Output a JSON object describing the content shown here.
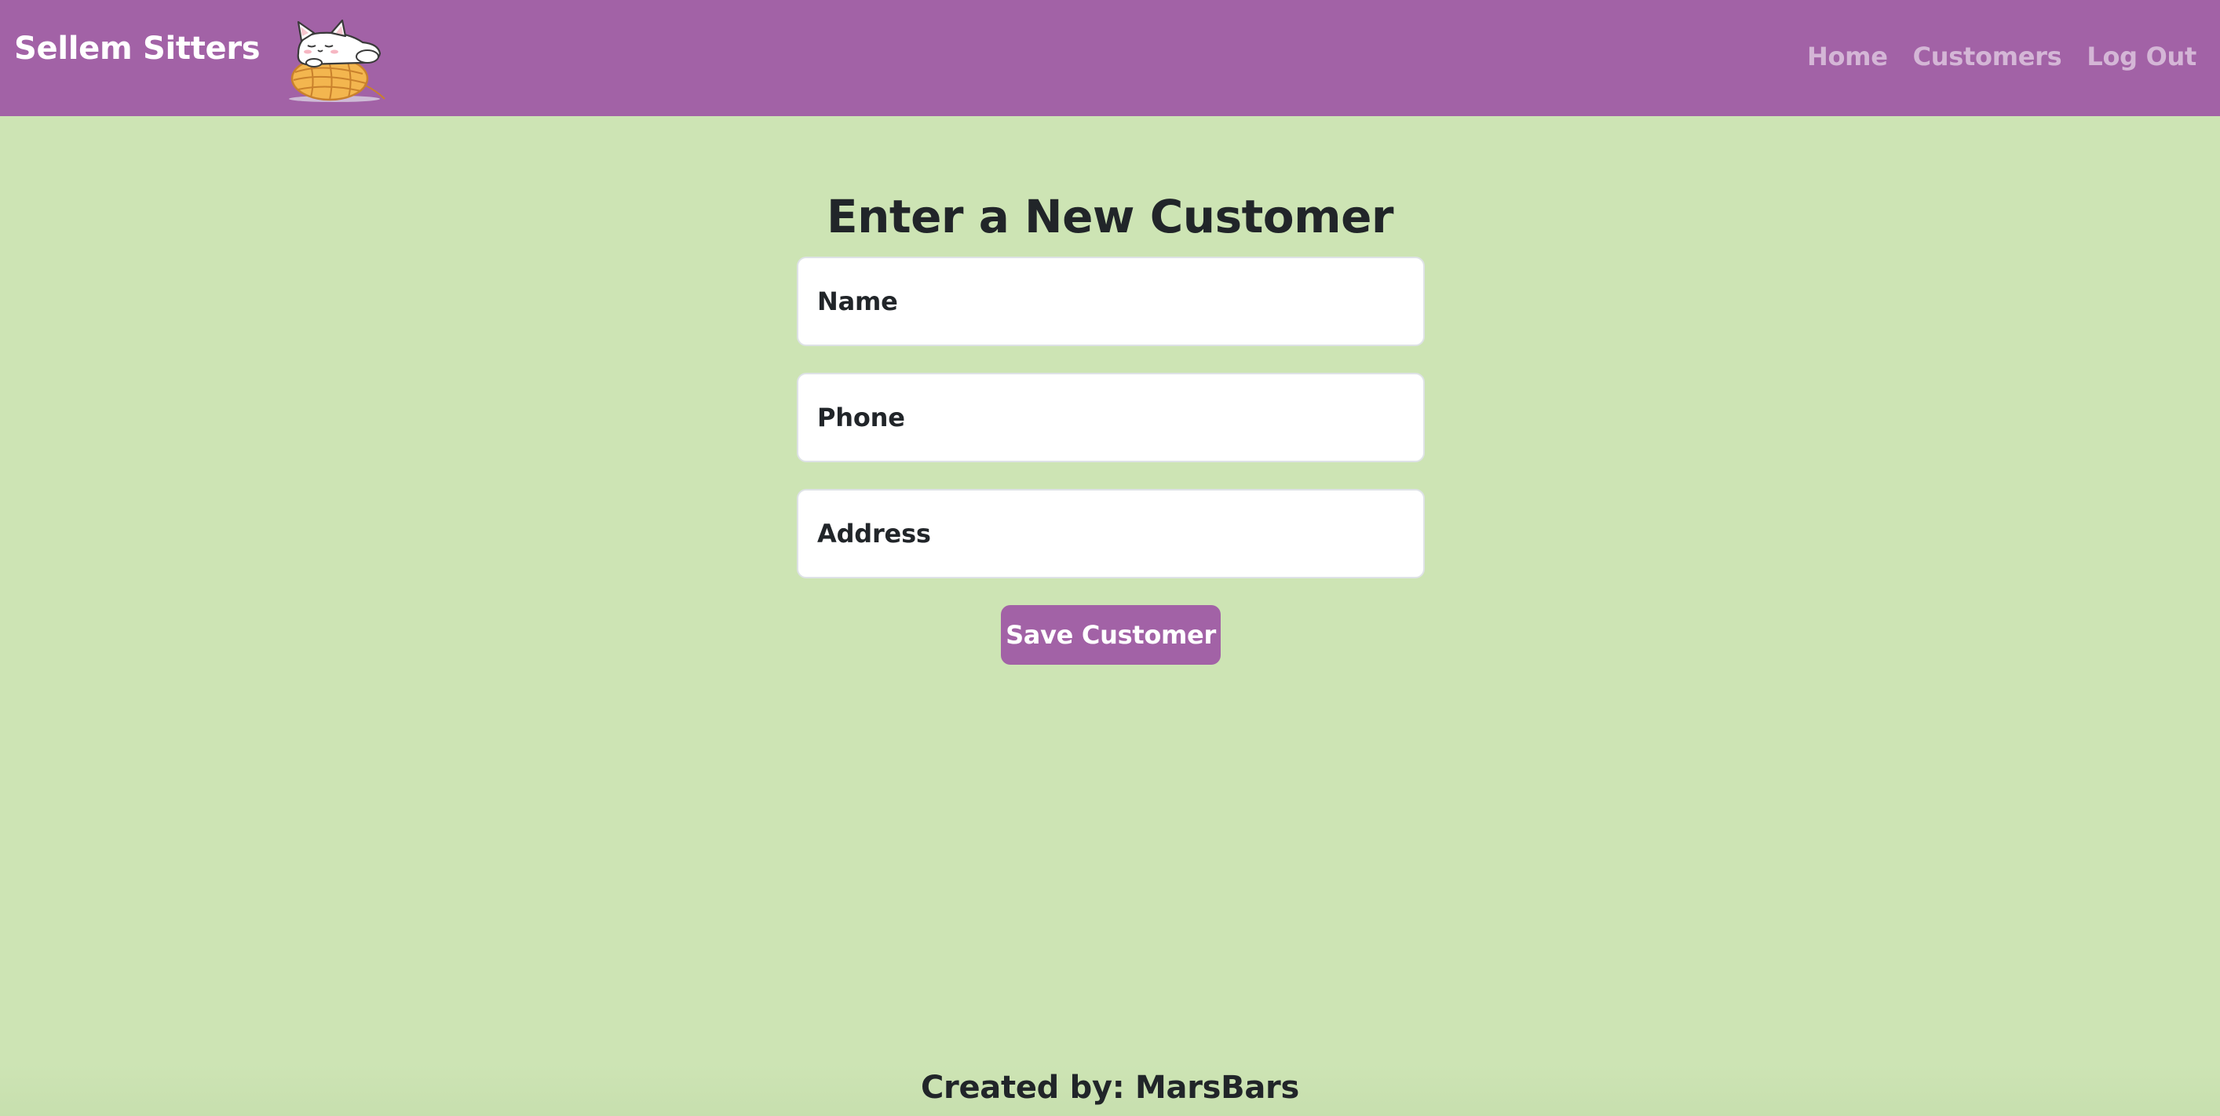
{
  "navbar": {
    "brand": "Sellem Sitters",
    "logo_icon": "cat-on-yarn-ball-icon",
    "links": [
      {
        "label": "Home"
      },
      {
        "label": "Customers"
      },
      {
        "label": "Log Out"
      }
    ]
  },
  "form": {
    "title": "Enter a New Customer",
    "fields": [
      {
        "label": "Name",
        "value": ""
      },
      {
        "label": "Phone",
        "value": ""
      },
      {
        "label": "Address",
        "value": ""
      }
    ],
    "submit_label": "Save Customer"
  },
  "footer": {
    "text": "Created by: MarsBars"
  },
  "colors": {
    "navbar": "#a262a6",
    "background": "#cde4b4",
    "nav_link": "#d4b6d6",
    "button": "#a262a6"
  }
}
